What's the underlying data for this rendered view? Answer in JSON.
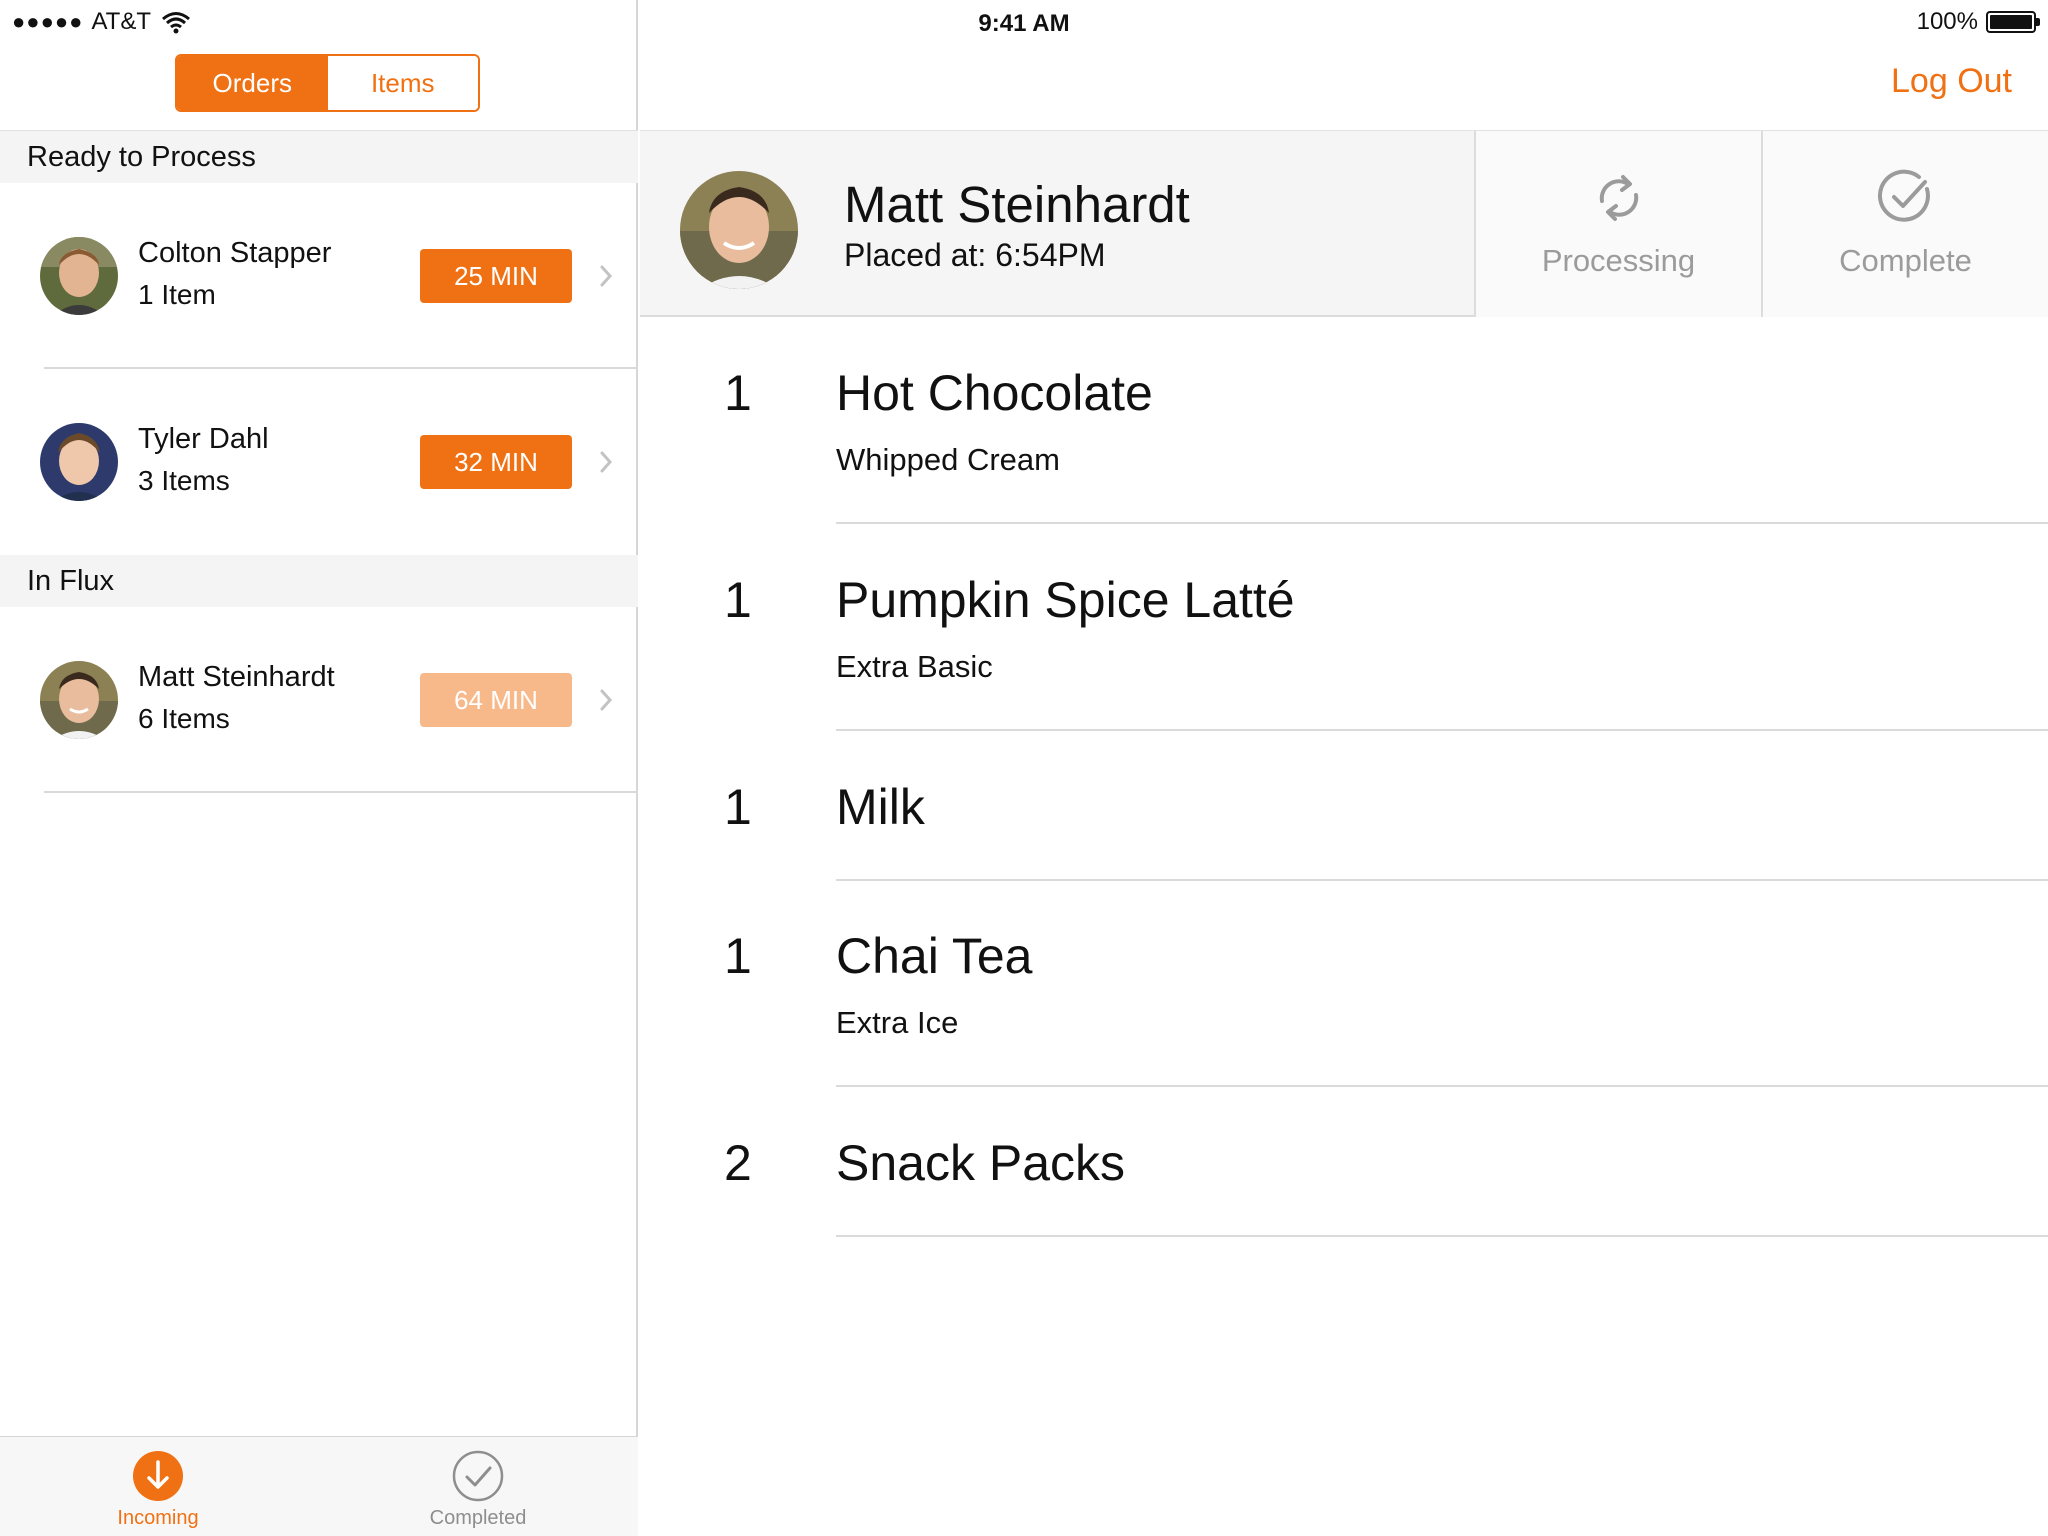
{
  "status_bar": {
    "carrier": "AT&T",
    "signal": "●●●●●",
    "time": "9:41 AM",
    "battery": "100%"
  },
  "segmented": {
    "orders": "Orders",
    "items": "Items",
    "selected": "Orders"
  },
  "sections": {
    "ready": "Ready to Process",
    "influx": "In Flux"
  },
  "orders": [
    {
      "name": "Colton Stapper",
      "count": "1 Item",
      "time": "25 MIN"
    },
    {
      "name": "Tyler Dahl",
      "count": "3 Items",
      "time": "32 MIN"
    },
    {
      "name": "Matt Steinhardt",
      "count": "6 Items",
      "time": "64 MIN"
    }
  ],
  "tabs": {
    "incoming": "Incoming",
    "completed": "Completed"
  },
  "nav": {
    "logout": "Log Out"
  },
  "detail": {
    "name": "Matt Steinhardt",
    "placed": "Placed at: 6:54PM",
    "processing": "Processing",
    "complete": "Complete"
  },
  "items": [
    {
      "qty": "1",
      "name": "Hot Chocolate",
      "note": "Whipped Cream"
    },
    {
      "qty": "1",
      "name": "Pumpkin Spice Latté",
      "note": "Extra Basic"
    },
    {
      "qty": "1",
      "name": "Milk",
      "note": ""
    },
    {
      "qty": "1",
      "name": "Chai Tea",
      "note": "Extra Ice"
    },
    {
      "qty": "2",
      "name": "Snack Packs",
      "note": ""
    }
  ],
  "colors": {
    "accent": "#f07113",
    "accent_dim": "#f8b98a",
    "muted": "#9b9b9b"
  },
  "icons": {
    "wifi": "wifi-icon",
    "battery": "battery-icon",
    "chevron": "chevron-right-icon",
    "incoming": "download-arrow-icon",
    "completed": "checkmark-circle-icon",
    "processing": "refresh-icon",
    "complete": "checkmark-circle-icon"
  }
}
